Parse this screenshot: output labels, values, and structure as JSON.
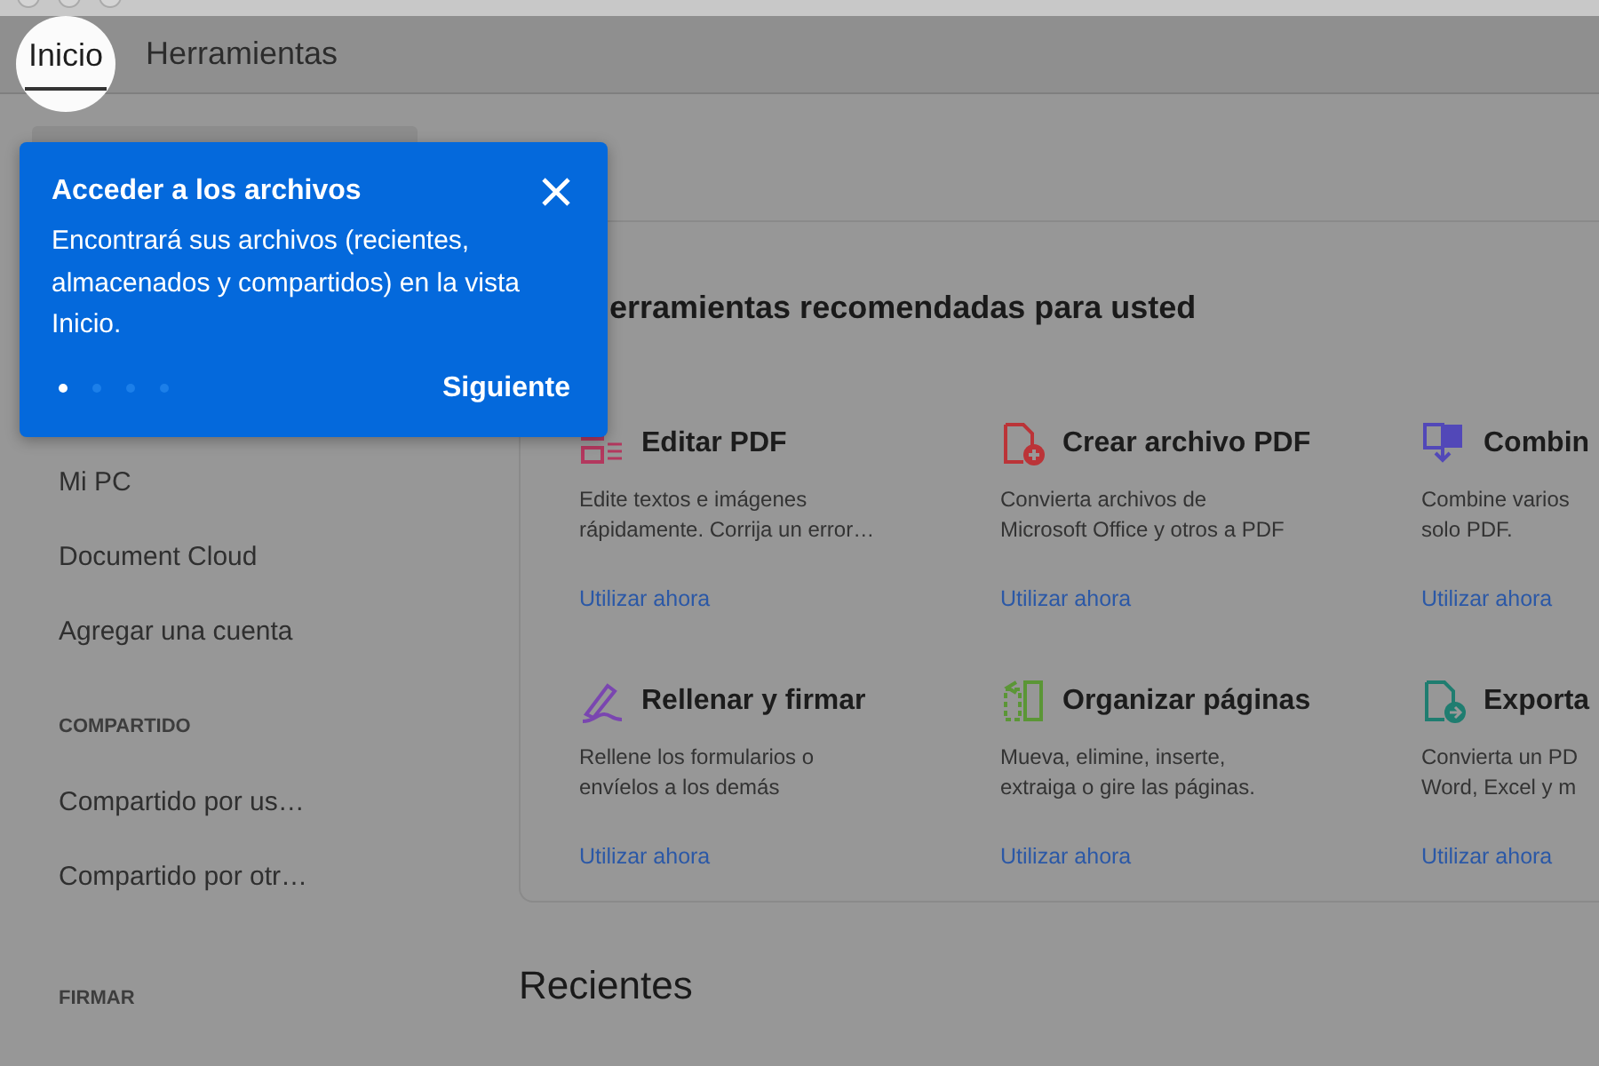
{
  "tabs": [
    {
      "label": "Inicio",
      "selected": true
    },
    {
      "label": "Herramientas",
      "selected": false
    }
  ],
  "sidebar": {
    "sections": [
      {
        "items": [
          "Mi PC",
          "Document Cloud",
          "Agregar una cuenta"
        ]
      },
      {
        "heading": "COMPARTIDO",
        "items": [
          "Compartido por us…",
          "Compartido por otr…"
        ]
      },
      {
        "heading": "FIRMAR"
      }
    ]
  },
  "tools_panel": {
    "heading": "erramientas recomendadas para usted",
    "tools": [
      {
        "kind": "edit",
        "color": "#b3385e",
        "title": "Editar PDF",
        "description": "Edite textos e imágenes\nrápidamente. Corrija un error…",
        "link": "Utilizar ahora"
      },
      {
        "kind": "create",
        "color": "#bb3438",
        "title": "Crear archivo PDF",
        "description": "Convierta archivos de\nMicrosoft Office y otros a PDF",
        "link": "Utilizar ahora"
      },
      {
        "kind": "combine",
        "color": "#5248b8",
        "title": "Combin",
        "description": "Combine varios\nsolo PDF.",
        "link": "Utilizar ahora"
      },
      {
        "kind": "sign",
        "color": "#7a46b0",
        "title": "Rellenar y firmar",
        "description": "Rellene los formularios o\nenvíelos a los demás",
        "link": "Utilizar ahora"
      },
      {
        "kind": "organize",
        "color": "#5b9636",
        "title": "Organizar páginas",
        "description": "Mueva, elimine, inserte,\nextraiga o gire las páginas.",
        "link": "Utilizar ahora"
      },
      {
        "kind": "export",
        "color": "#1f7d70",
        "title": "Exporta",
        "description": "Convierta un PD\nWord, Excel y m",
        "link": "Utilizar ahora"
      }
    ]
  },
  "recent": {
    "heading": "Recientes"
  },
  "coach_mark": {
    "title": "Acceder a los archivos",
    "text": "Encontrará sus archivos (recientes, almacenados y compartidos) en la vista Inicio.",
    "next_button": "Siguiente",
    "steps": [
      {
        "selected": true
      },
      {
        "selected": false
      },
      {
        "selected": false
      },
      {
        "selected": false
      }
    ]
  }
}
